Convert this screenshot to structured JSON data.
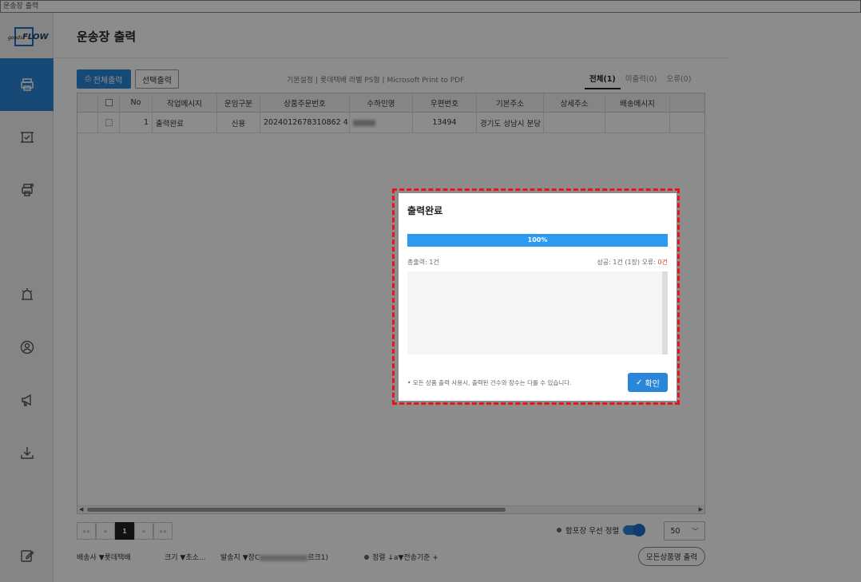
{
  "window": {
    "title": "운송장 출력"
  },
  "sidebar": {
    "logo_prefix": "goods",
    "logo_text": "FLOW",
    "items": [
      {
        "icon": "printer-icon",
        "active": true
      },
      {
        "icon": "frame-check-icon",
        "active": false
      },
      {
        "icon": "multi-printer-icon",
        "active": false
      },
      {
        "icon": "alarm-icon",
        "active": false
      },
      {
        "icon": "user-circle-icon",
        "active": false
      },
      {
        "icon": "megaphone-icon",
        "active": false
      },
      {
        "icon": "download-icon",
        "active": false
      },
      {
        "icon": "edit-icon",
        "active": false
      }
    ]
  },
  "header": {
    "title": "운송장 출력"
  },
  "toolbar": {
    "print_all_label": "전체출력",
    "print_selected_label": "선택출력",
    "printer_info": "기본설정 | 롯데택배 라벨 PS형 | Microsoft Print to PDF"
  },
  "tabs": [
    {
      "label": "전체(1)",
      "active": true
    },
    {
      "label": "미출력(0)",
      "active": false
    },
    {
      "label": "오류(0)",
      "active": false
    }
  ],
  "table": {
    "columns": [
      "No",
      "작업메시지",
      "운임구분",
      "상품주문번호",
      "수하인명",
      "우편번호",
      "기본주소",
      "상세주소",
      "배송메시지"
    ],
    "rows": [
      {
        "no": "1",
        "message": "출력완료",
        "fare": "신용",
        "order_no": "2024012678310862 4",
        "postal": "13494",
        "address": "경기도 성남시 분당",
        "detail": "",
        "delivery_msg": ""
      }
    ]
  },
  "pagination": {
    "first": "««",
    "prev": "«",
    "current": "1",
    "next": "»",
    "last": "»»"
  },
  "bundle_toggle": {
    "label": "합포장 우선 정렬",
    "on": true
  },
  "per_page": {
    "value": "50"
  },
  "bottom": {
    "carrier": "배송사 ▼롯데택배",
    "size": "크기 ▼초소...",
    "sender_prefix": "발송지 ▼장C",
    "sender_suffix": "르크1)",
    "sort": "정렬 ↓a▼전송기준 +",
    "all_products_button": "모든상품명 출력"
  },
  "modal": {
    "title": "출력완료",
    "progress": 100,
    "progress_label": "100%",
    "total": "총출력: 1건",
    "success": "성공: 1건 (1장) 오류: ",
    "error_count": "0건",
    "notice": "• 모든 상품 출력 사용시, 출력된 건수와 장수는 다를 수 있습니다.",
    "ok_label": "확인"
  },
  "colors": {
    "accent": "#2a86d8",
    "progress": "#2a9bf0",
    "error": "#e23c2c",
    "highlight": "#e8141a"
  }
}
